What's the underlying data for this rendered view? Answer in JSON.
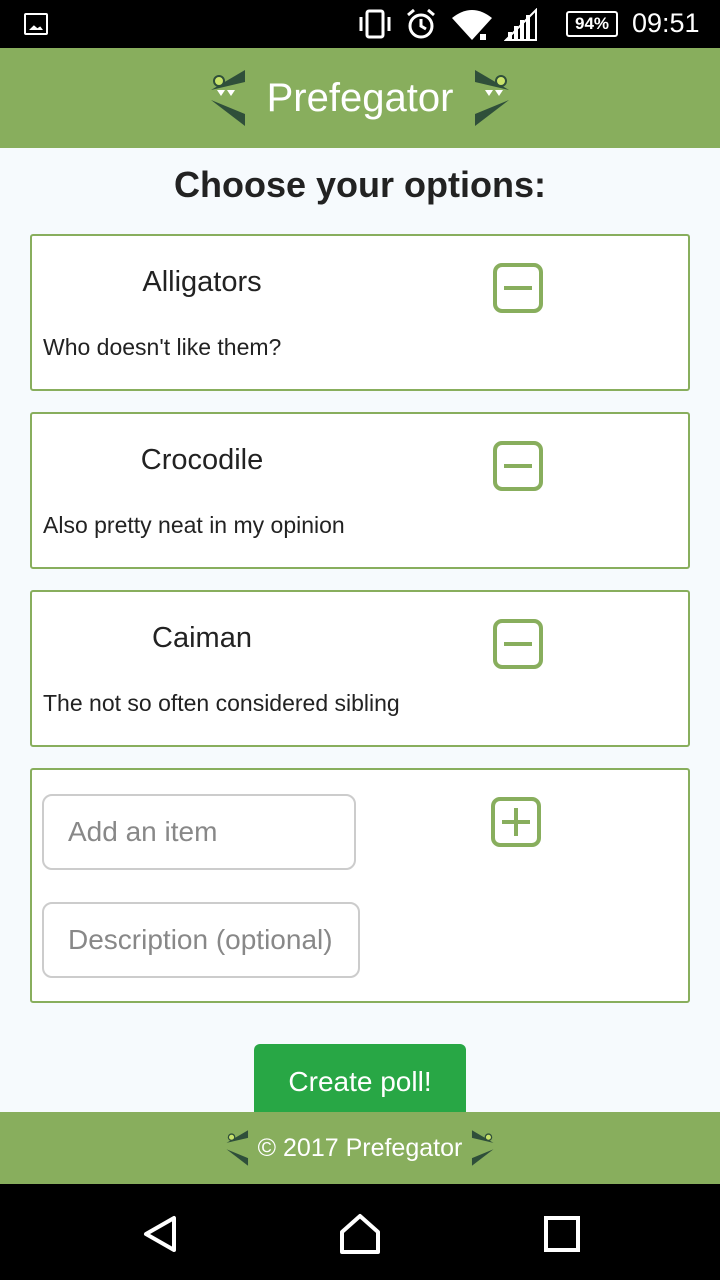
{
  "status_bar": {
    "battery": "94%",
    "time": "09:51",
    "icons": [
      "image-notification-icon",
      "vibrate-icon",
      "alarm-icon",
      "wifi-icon",
      "signal-icon",
      "battery-icon"
    ]
  },
  "app_bar": {
    "title": "Prefegator",
    "logo_icon": "alligator-jaw-icon"
  },
  "page": {
    "heading": "Choose your options:"
  },
  "options": [
    {
      "name": "Alligators",
      "description": "Who doesn't like them?",
      "action_icon": "remove-icon"
    },
    {
      "name": "Crocodile",
      "description": "Also pretty neat in my opinion",
      "action_icon": "remove-icon"
    },
    {
      "name": "Caiman",
      "description": "The not so often considered sibling",
      "action_icon": "remove-icon"
    }
  ],
  "add_item": {
    "item_placeholder": "Add an item",
    "description_placeholder": "Description (optional)",
    "action_icon": "add-icon"
  },
  "create_button": "Create poll!",
  "footer": {
    "text": "© 2017 Prefegator"
  },
  "nav_bar": {
    "icons": [
      "back-icon",
      "home-icon",
      "recents-icon"
    ]
  },
  "colors": {
    "brand_green": "#88ae5d",
    "button_green": "#28a745",
    "background": "#f6fafd"
  }
}
